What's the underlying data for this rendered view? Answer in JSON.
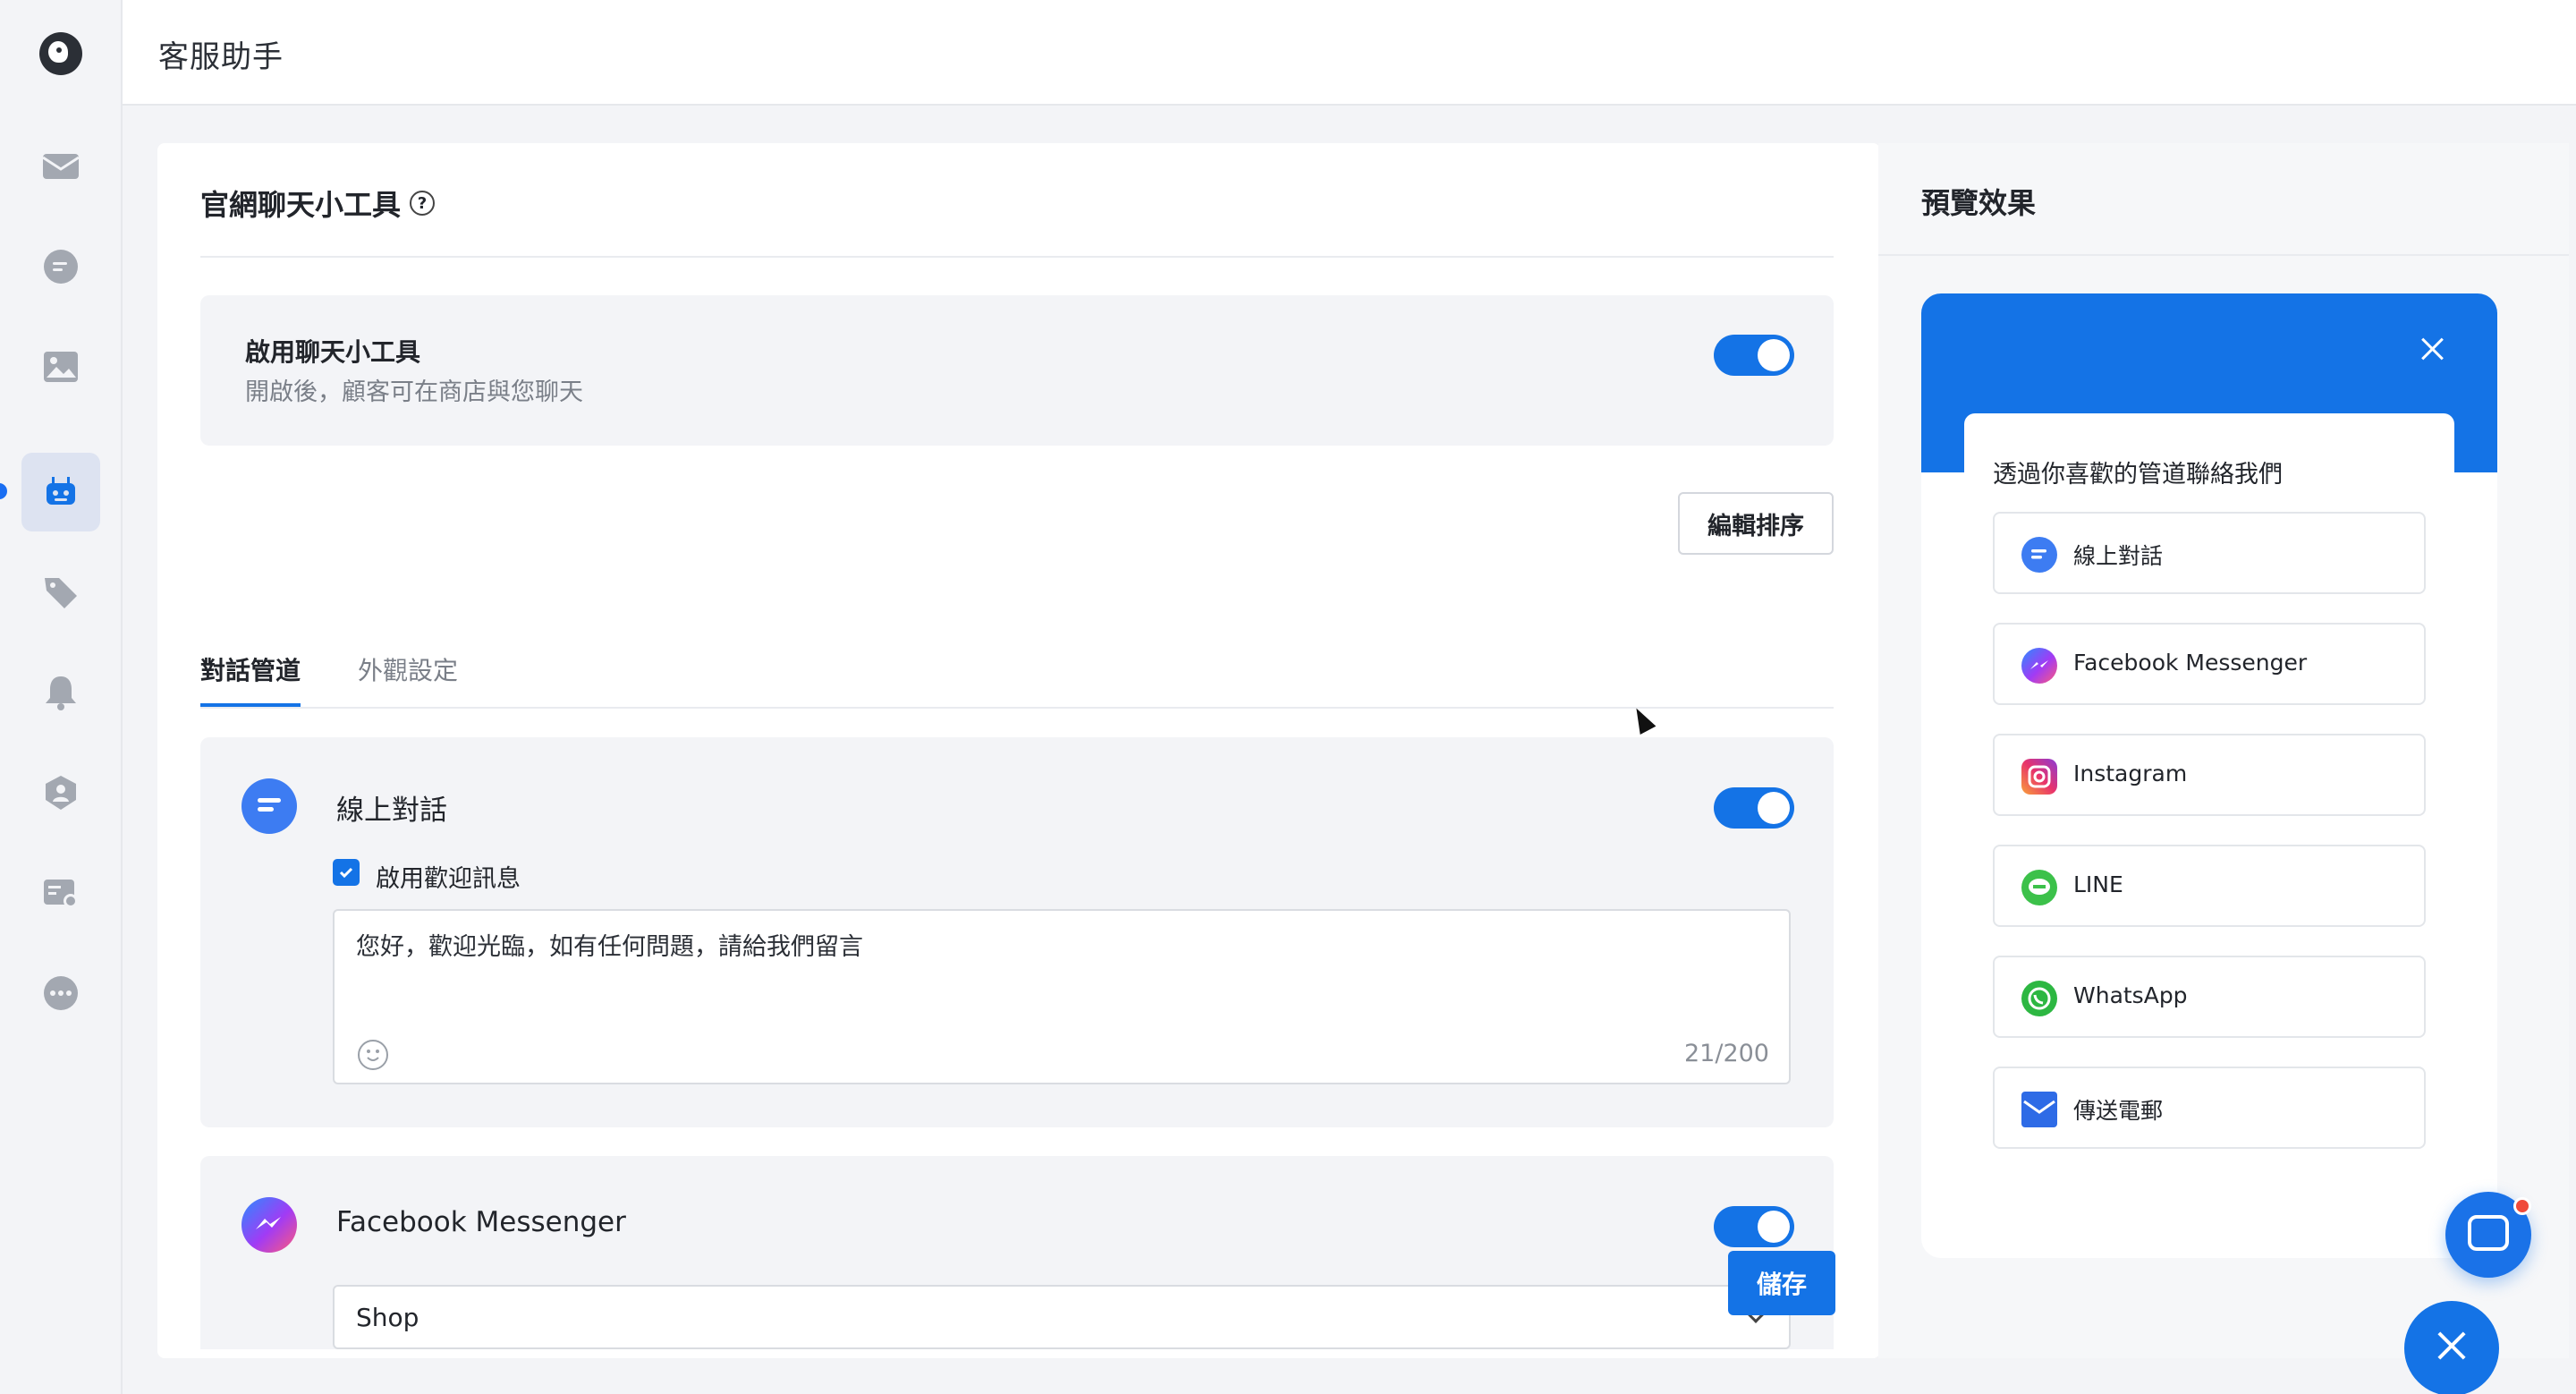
{
  "app": {
    "title": "客服助手"
  },
  "sidebar": {
    "items": [
      {
        "icon": "mail-icon"
      },
      {
        "icon": "chat-bubble-icon"
      },
      {
        "icon": "image-icon"
      },
      {
        "icon": "robot-icon",
        "active": true
      },
      {
        "icon": "tag-icon"
      },
      {
        "icon": "bell-icon"
      },
      {
        "icon": "user-shield-icon"
      },
      {
        "icon": "card-settings-icon"
      },
      {
        "icon": "more-icon"
      }
    ]
  },
  "widget_settings": {
    "title": "官網聊天小工具",
    "help_icon": "?",
    "enable": {
      "title": "啟用聊天小工具",
      "description": "開啟後，顧客可在商店與您聊天",
      "on": true
    },
    "tabs": [
      {
        "label": "對話管道",
        "active": true
      },
      {
        "label": "外觀設定",
        "active": false
      }
    ],
    "edit_order_label": "編輯排序",
    "channels": [
      {
        "name": "線上對話",
        "on": true,
        "welcome_checkbox_label": "啟用歡迎訊息",
        "welcome_checked": true,
        "welcome_text": "您好，歡迎光臨，如有任何問題，請給我們留言",
        "char_count": "21/200"
      },
      {
        "name": "Facebook Messenger",
        "on": true,
        "page_select_value": "Shop"
      }
    ],
    "save_label": "儲存"
  },
  "preview": {
    "title": "預覽效果",
    "widget_heading": "透過你喜歡的管道聯絡我們",
    "buttons": [
      {
        "label": "線上對話",
        "icon": "live-chat-icon"
      },
      {
        "label": "Facebook Messenger",
        "icon": "messenger-icon"
      },
      {
        "label": "Instagram",
        "icon": "instagram-icon"
      },
      {
        "label": "LINE",
        "icon": "line-icon"
      },
      {
        "label": "WhatsApp",
        "icon": "whatsapp-icon"
      },
      {
        "label": "傳送電郵",
        "icon": "email-icon"
      }
    ]
  },
  "colors": {
    "accent": "#1473e6",
    "sidebar_active_bg": "#dde3f1",
    "panel_bg": "#f3f4f7"
  }
}
